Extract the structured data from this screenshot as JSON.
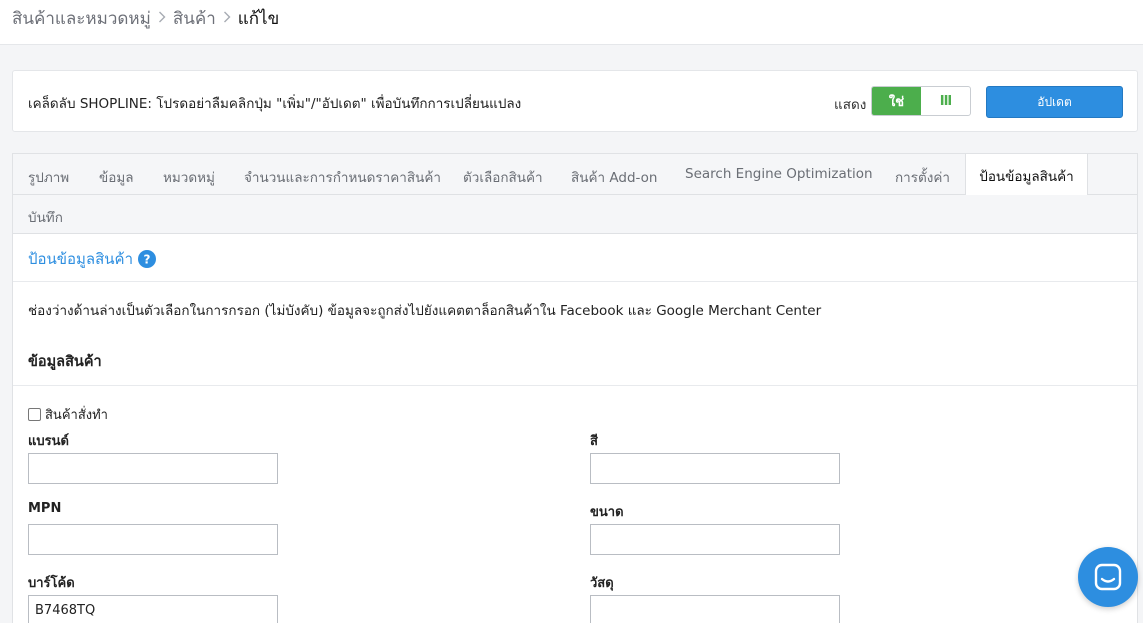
{
  "breadcrumb": {
    "items": [
      "สินค้าและหมวดหมู่",
      "สินค้า",
      "แก้ไข"
    ],
    "separator": ">"
  },
  "tip": {
    "text": "เคล็ดลับ SHOPLINE: โปรดอย่าลืมคลิกปุ่ม \"เพิ่ม\"/\"อัปเดต\" เพื่อบันทึกการเปลี่ยนแปลง",
    "show_label": "แสดง",
    "toggle_on": "ใช่",
    "toggle_off": "III",
    "update_button": "อัปเดต"
  },
  "tabs": [
    {
      "label": "รูปภาพ"
    },
    {
      "label": "ข้อมูล"
    },
    {
      "label": "หมวดหมู่"
    },
    {
      "label": "จำนวนและการกำหนดราคาสินค้า"
    },
    {
      "label": "ตัวเลือกสินค้า"
    },
    {
      "label": "สินค้า Add-on"
    },
    {
      "label": "Search Engine Optimization"
    },
    {
      "label": "การตั้งค่า"
    },
    {
      "label": "ป้อนข้อมูลสินค้า",
      "active": true
    },
    {
      "label": "บันทึก"
    }
  ],
  "section": {
    "title": "ป้อนข้อมูลสินค้า",
    "description": "ช่องว่างด้านล่างเป็นตัวเลือกในการกรอก (ไม่บังคับ) ข้อมูลจะถูกส่งไปยังแคตตาล็อกสินค้าใน Facebook และ Google Merchant Center",
    "subtitle": "ข้อมูลสินค้า"
  },
  "custom_product_checkbox": {
    "label": "สินค้าสั่งทำ",
    "checked": false
  },
  "fields": {
    "brand": {
      "label": "แบรนด์",
      "value": ""
    },
    "color": {
      "label": "สี",
      "value": ""
    },
    "mpn": {
      "label": "MPN",
      "value": ""
    },
    "size": {
      "label": "ขนาด",
      "value": ""
    },
    "barcode": {
      "label": "บาร์โค้ด",
      "value": "B7468TQ"
    },
    "material": {
      "label": "วัสดุ",
      "value": ""
    }
  },
  "colors": {
    "accent": "#2d8ee0",
    "toggle_green": "#4cae4c"
  },
  "icons": {
    "help": "question-circle-icon",
    "chat": "chat-icon",
    "separator": "chevron-right-icon"
  }
}
